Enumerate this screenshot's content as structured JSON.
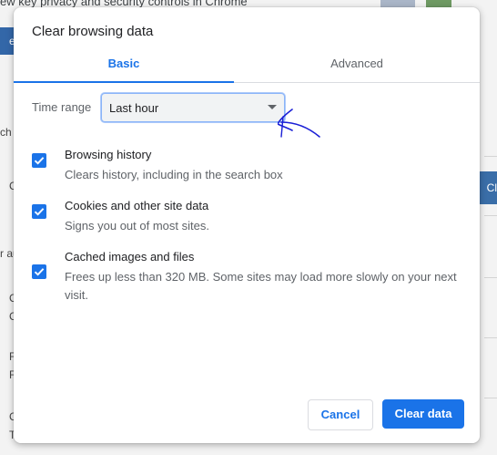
{
  "background": {
    "top_text": "ew key privacy and security controls in Chrome",
    "left_button_fragment": "et",
    "right_button_fragment": "Cl",
    "left_letters": [
      "ch",
      "C",
      "r au",
      "C",
      "C",
      "F",
      "F",
      "C",
      "T"
    ]
  },
  "dialog": {
    "title": "Clear browsing data",
    "tabs": [
      {
        "label": "Basic",
        "selected": true
      },
      {
        "label": "Advanced",
        "selected": false
      }
    ],
    "time_range": {
      "label": "Time range",
      "value": "Last hour"
    },
    "options": [
      {
        "title": "Browsing history",
        "description": "Clears history, including in the search box",
        "checked": true
      },
      {
        "title": "Cookies and other site data",
        "description": "Signs you out of most sites.",
        "checked": true
      },
      {
        "title": "Cached images and files",
        "description": "Frees up less than 320 MB. Some sites may load more slowly on your next visit.",
        "checked": true
      }
    ],
    "buttons": {
      "cancel": "Cancel",
      "clear": "Clear data"
    }
  },
  "colors": {
    "accent": "#1a73e8",
    "annotation": "#1a1fd6"
  }
}
